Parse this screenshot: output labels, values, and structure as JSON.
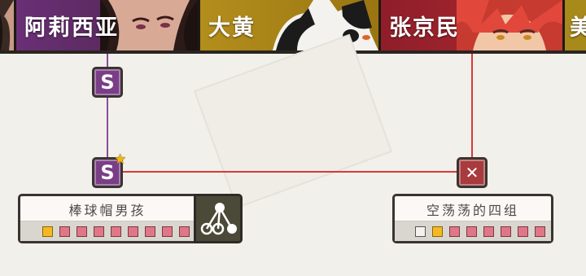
{
  "header": {
    "tabs": [
      {
        "name": ""
      },
      {
        "name": "阿莉西亚"
      },
      {
        "name": "大黄"
      },
      {
        "name": "张京民"
      },
      {
        "name": "美"
      }
    ]
  },
  "nodes": {
    "s_top_label": "S",
    "s_bottom_label": "S",
    "x_label": "✕"
  },
  "cards": {
    "left": {
      "title": "棒球帽男孩",
      "slots": [
        "gold",
        "pink",
        "pink",
        "pink",
        "pink",
        "pink",
        "pink",
        "pink",
        "pink"
      ]
    },
    "right": {
      "title": "空荡荡的四组",
      "slots": [
        "empty",
        "gold",
        "pink",
        "pink",
        "pink",
        "pink",
        "pink",
        "pink"
      ]
    }
  },
  "colors": {
    "purple_line": "#8a4d9a",
    "red_line": "#d63a3a",
    "node_purple": "#7a3e86",
    "node_red": "#a73b3e",
    "slot_pink": "#e07788",
    "slot_gold": "#f4b920"
  },
  "icons": {
    "star": "star-icon",
    "tree": "tree-structure-icon",
    "close": "close-icon"
  }
}
